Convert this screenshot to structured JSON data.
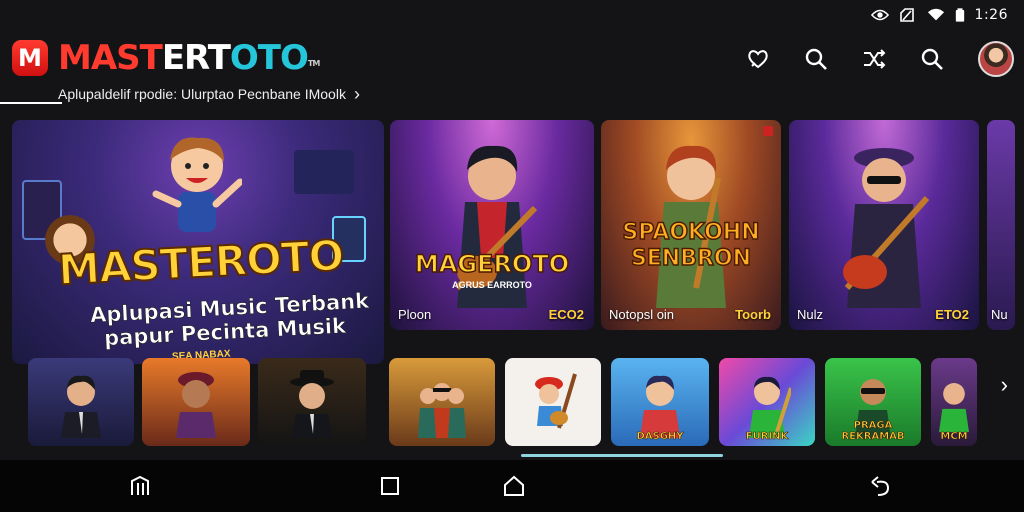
{
  "status_bar": {
    "time": "1:26"
  },
  "header": {
    "logo_letter": "M",
    "brand_part1": "MAST",
    "brand_part2": "ERT",
    "brand_part3": "OTO",
    "brand_tm": "TM",
    "subtitle": "Aplupaldelif rpodie: Ulurptao Pecnbane IMoolk",
    "subtitle_chevron": "›"
  },
  "hero": {
    "title": "MASTEROTO",
    "line1": "Aplupasi Music Terbank",
    "line2": "papur Pecinta Musik",
    "line3": "SEA NABAX"
  },
  "featured": [
    {
      "big": "MAGEROTO",
      "sub": "AGRUS EARROTO",
      "label": "Ploon",
      "tag": "ECO2"
    },
    {
      "big": "SPAOKOHN SENBRON",
      "sub": "",
      "label": "Notopsl oin",
      "tag": "Toorb"
    },
    {
      "big": "",
      "sub": "",
      "label": "Nulz",
      "tag": "ETO2"
    },
    {
      "big": "",
      "sub": "",
      "label": "Nu",
      "tag": ""
    }
  ],
  "thumbs": [
    {
      "label": ""
    },
    {
      "label": ""
    },
    {
      "label": ""
    },
    {
      "label": ""
    },
    {
      "label": ""
    },
    {
      "label": "DASGHY"
    },
    {
      "label": "FURINK"
    },
    {
      "label": "PRAGA REKRAMAB"
    },
    {
      "label": "MCM"
    }
  ],
  "icons": {
    "header": [
      "heart-chat-icon",
      "search-icon",
      "shuffle-icon",
      "search-icon"
    ],
    "nav": [
      "menu-icon",
      "recent-apps-icon",
      "home-icon",
      "back-icon"
    ],
    "scroll_arrow": "›"
  },
  "colors": {
    "brand_red": "#ff3b30",
    "brand_teal": "#26c6da",
    "accent_gold": "#ffd23a",
    "scroll_indicator": "#8fd3e0"
  }
}
